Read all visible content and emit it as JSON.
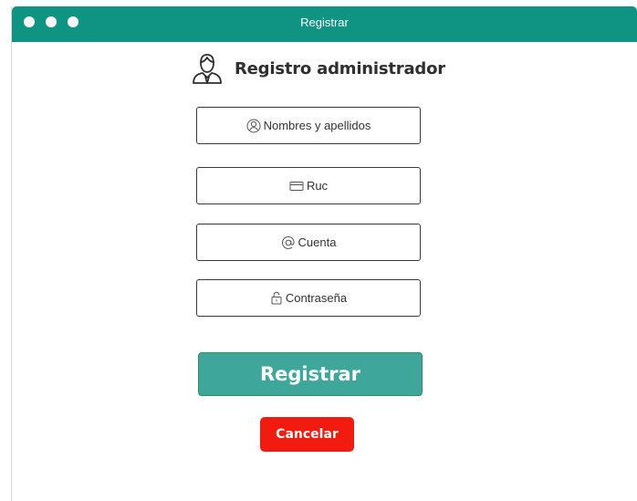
{
  "window": {
    "title": "Registrar"
  },
  "form": {
    "heading": "Registro administrador",
    "heading_icon": "user-icon",
    "fields": [
      {
        "placeholder": "Nombres y apellidos",
        "icon": "user-circle-icon"
      },
      {
        "placeholder": "Ruc",
        "icon": "card-icon"
      },
      {
        "placeholder": "Cuenta",
        "icon": "at-icon"
      },
      {
        "placeholder": "Contraseña",
        "icon": "lock-icon"
      }
    ],
    "register_label": "Registrar",
    "cancel_label": "Cancelar"
  },
  "colors": {
    "titlebar": "#0f9382",
    "register_button": "#3ea69a",
    "cancel_button": "#f21b0f"
  }
}
